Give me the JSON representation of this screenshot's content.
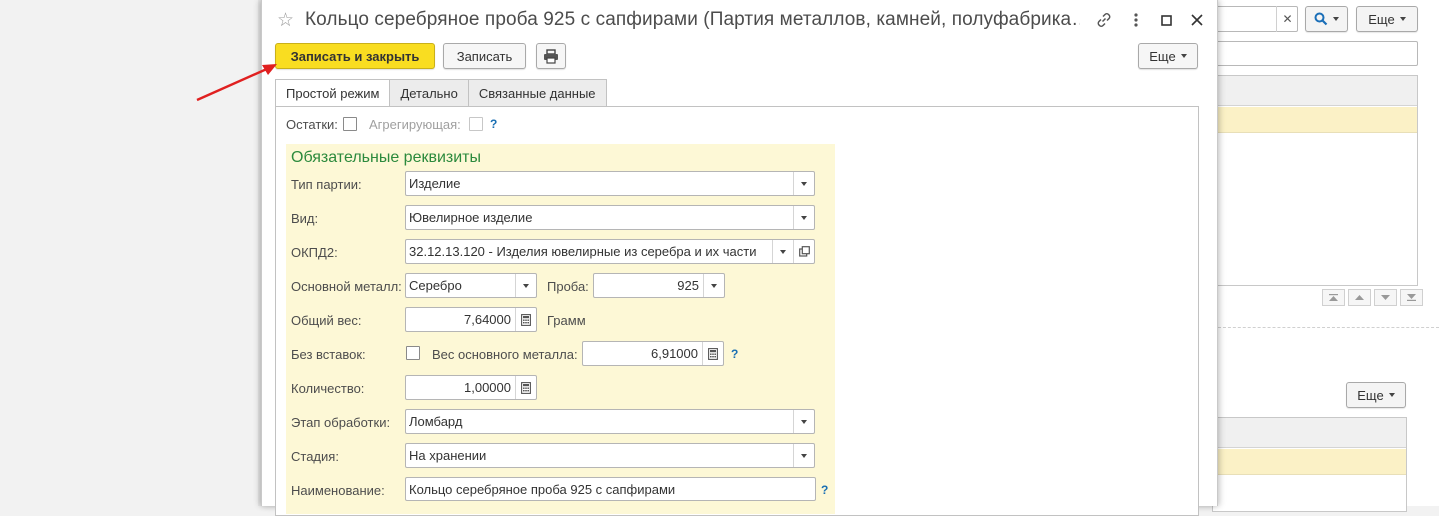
{
  "background_window": {
    "more_label": "Еще",
    "more_label_2": "Еще"
  },
  "dialog": {
    "title": "Кольцо серебряное проба 925 с сапфирами (Партия металлов, камней, полуфабрика…",
    "toolbar": {
      "save_close_label": "Записать и закрыть",
      "save_label": "Записать",
      "more_label": "Еще"
    },
    "tabs": [
      {
        "label": "Простой режим",
        "active": true
      },
      {
        "label": "Детально",
        "active": false
      },
      {
        "label": "Связанные данные",
        "active": false
      }
    ],
    "top_row": {
      "ostatki_label": "Остатки:",
      "agg_label": "Агрегирующая:",
      "help": "?"
    },
    "required": {
      "title": "Обязательные реквизиты",
      "party_type_label": "Тип партии:",
      "party_type_value": "Изделие",
      "kind_label": "Вид:",
      "kind_value": "Ювелирное изделие",
      "okpd_label": "ОКПД2:",
      "okpd_value": "32.12.13.120 - Изделия ювелирные из серебра и их части",
      "metal_label": "Основной металл:",
      "metal_value": "Серебро",
      "proba_label": "Проба:",
      "proba_value": "925",
      "weight_label": "Общий вес:",
      "weight_value": "7,64000",
      "weight_unit": "Грамм",
      "no_inserts_label": "Без вставок:",
      "metal_weight_label": "Вес основного металла:",
      "metal_weight_value": "6,91000",
      "qty_label": "Количество:",
      "qty_value": "1,00000",
      "stage_label": "Этап обработки:",
      "stage_value": "Ломбард",
      "phase_label": "Стадия:",
      "phase_value": "На хранении",
      "name_label": "Наименование:",
      "name_value": "Кольцо серебряное проба 925 с сапфирами",
      "help": "?"
    }
  },
  "colors": {
    "primary_button": "#f9dd21",
    "required_bg": "#fdf8d6",
    "required_title": "#2c8a3d",
    "annotation_arrow": "#e02020",
    "selected_row": "#fbf1c6"
  }
}
